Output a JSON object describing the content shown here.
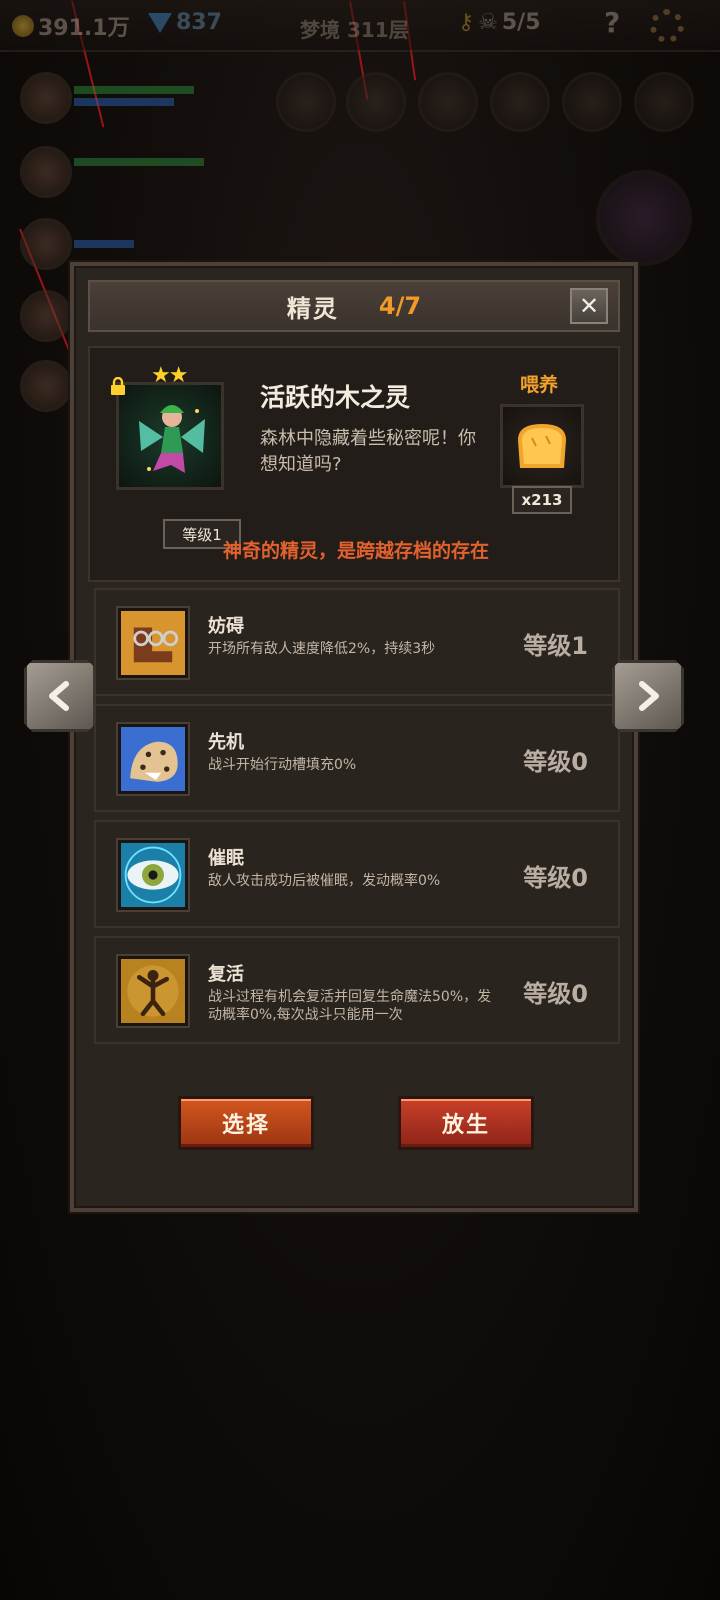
{
  "topbar": {
    "gold": "391.1万",
    "gems": "837",
    "floor": "梦境 311层",
    "keys": "5/5",
    "help": "?"
  },
  "modal": {
    "title": "精灵",
    "page": "4/7",
    "close": "✕"
  },
  "spirit": {
    "stars": "★★",
    "level": "等级1",
    "name": "活跃的木之灵",
    "description": "森林中隐藏着些秘密呢！你想知道吗?",
    "feed_label": "喂养",
    "food_count": "x213",
    "tagline": "神奇的精灵，是跨越存档的存在"
  },
  "skills": [
    {
      "name": "妨碍",
      "desc": "开场所有敌人速度降低2%，持续3秒",
      "level": "等级1",
      "icon": "chain-boot-icon"
    },
    {
      "name": "先机",
      "desc": "战斗开始行动槽填充0%",
      "level": "等级0",
      "icon": "leopard-icon"
    },
    {
      "name": "催眠",
      "desc": "敌人攻击成功后被催眠，发动概率0%",
      "level": "等级0",
      "icon": "eye-icon"
    },
    {
      "name": "复活",
      "desc": "战斗过程有机会复活并回复生命魔法50%，发动概率0%,每次战斗只能用一次",
      "level": "等级0",
      "icon": "revive-figure-icon"
    }
  ],
  "buttons": {
    "select": "选择",
    "release": "放生"
  },
  "colors": {
    "accent_orange": "#f29a27",
    "tagline_red": "#e2612e",
    "button_select": "#d2571f",
    "button_release": "#c9402a"
  }
}
